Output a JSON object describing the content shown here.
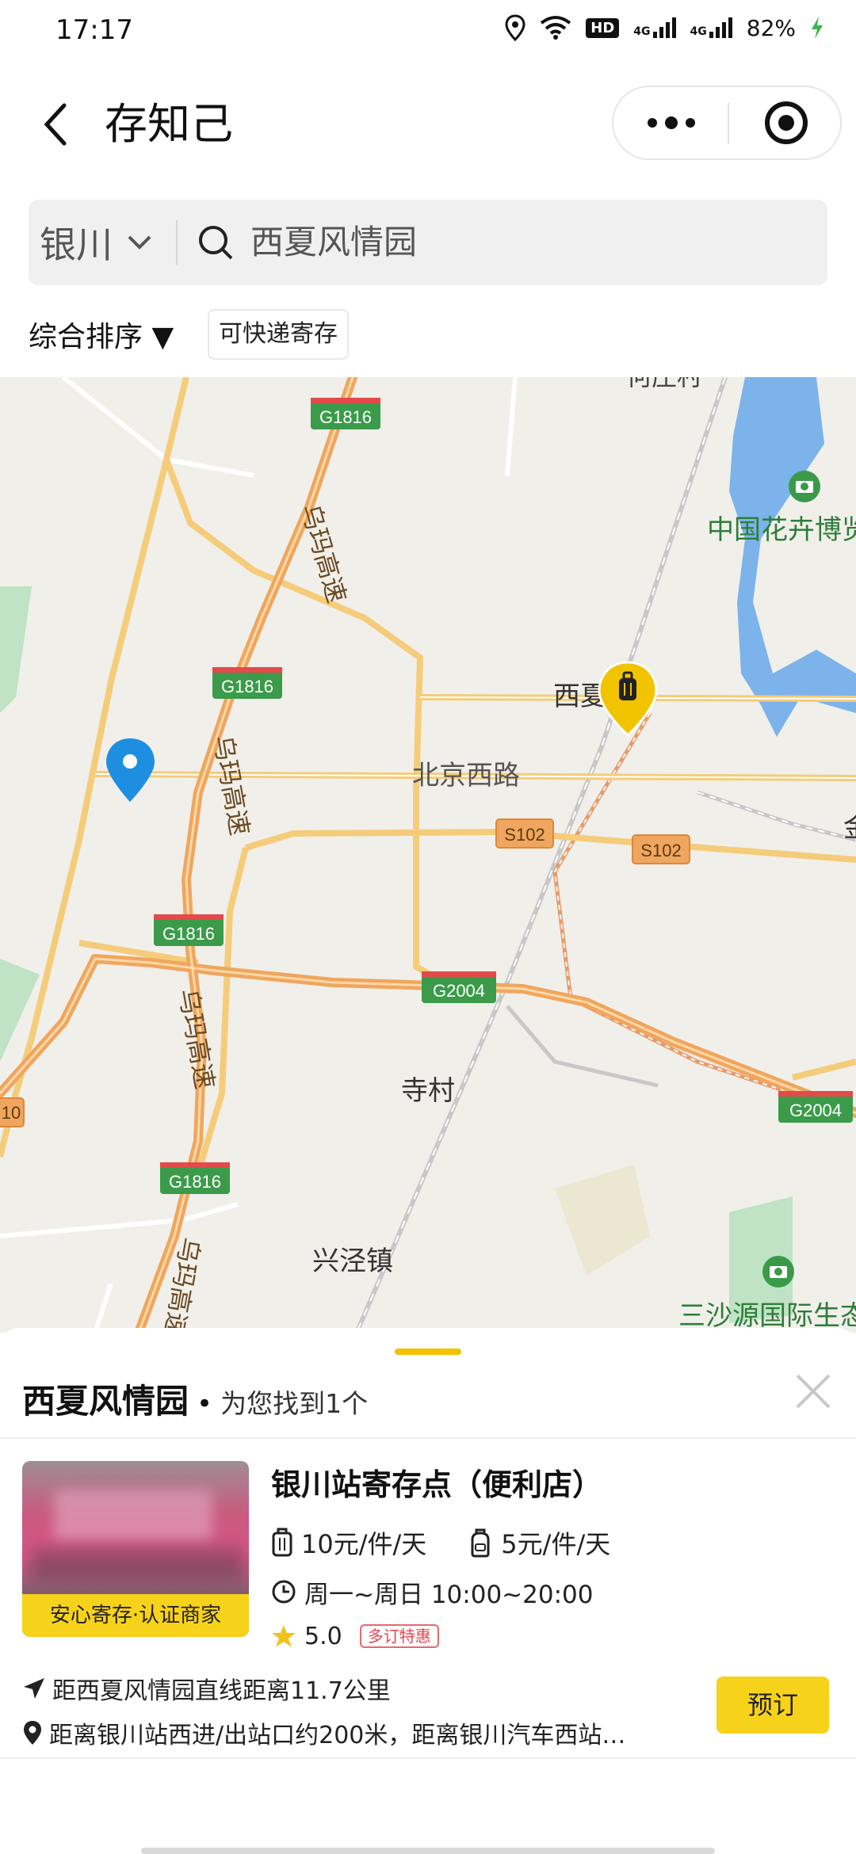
{
  "status_bar": {
    "time": "17:17",
    "battery": "82%",
    "net1": "4G",
    "net2": "4G",
    "hd": "HD"
  },
  "header": {
    "title": "存知己"
  },
  "search": {
    "city": "银川",
    "query": "西夏风情园"
  },
  "filters": {
    "sort_label": "综合排序 ▼",
    "chip": "可快递寄存"
  },
  "map": {
    "labels": {
      "village_top": "何庄村",
      "flower_expo": "中国花卉博览",
      "xixia": "西夏",
      "beijing_road": "北京西路",
      "sicun": "寺村",
      "xingjing": "兴泾镇",
      "sansha": "三沙源国际生态",
      "right_edge": "金",
      "left_edge": "10"
    },
    "road_shields": {
      "g1816": "G1816",
      "s102": "S102",
      "g2004": "G2004"
    },
    "expressway": "乌玛高速",
    "colors": {
      "accent": "#f7d21a",
      "user_pin": "#1e8fe0",
      "shield_green": "#3b9b4a"
    }
  },
  "sheet": {
    "title": "西夏风情园",
    "dot": "•",
    "count_text": "为您找到1个",
    "listing": {
      "badge": "安心寄存·认证商家",
      "name": "银川站寄存点（便利店）",
      "price_luggage": "10元/件/天",
      "price_backpack": "5元/件/天",
      "hours": "周一~周日 10:00~20:00",
      "rating": "5.0",
      "promo": "多订特惠",
      "distance": "距西夏风情园直线距离11.7公里",
      "location": "距离银川站西进/出站口约200米，距离银川汽车西站…",
      "book_label": "预订"
    }
  }
}
